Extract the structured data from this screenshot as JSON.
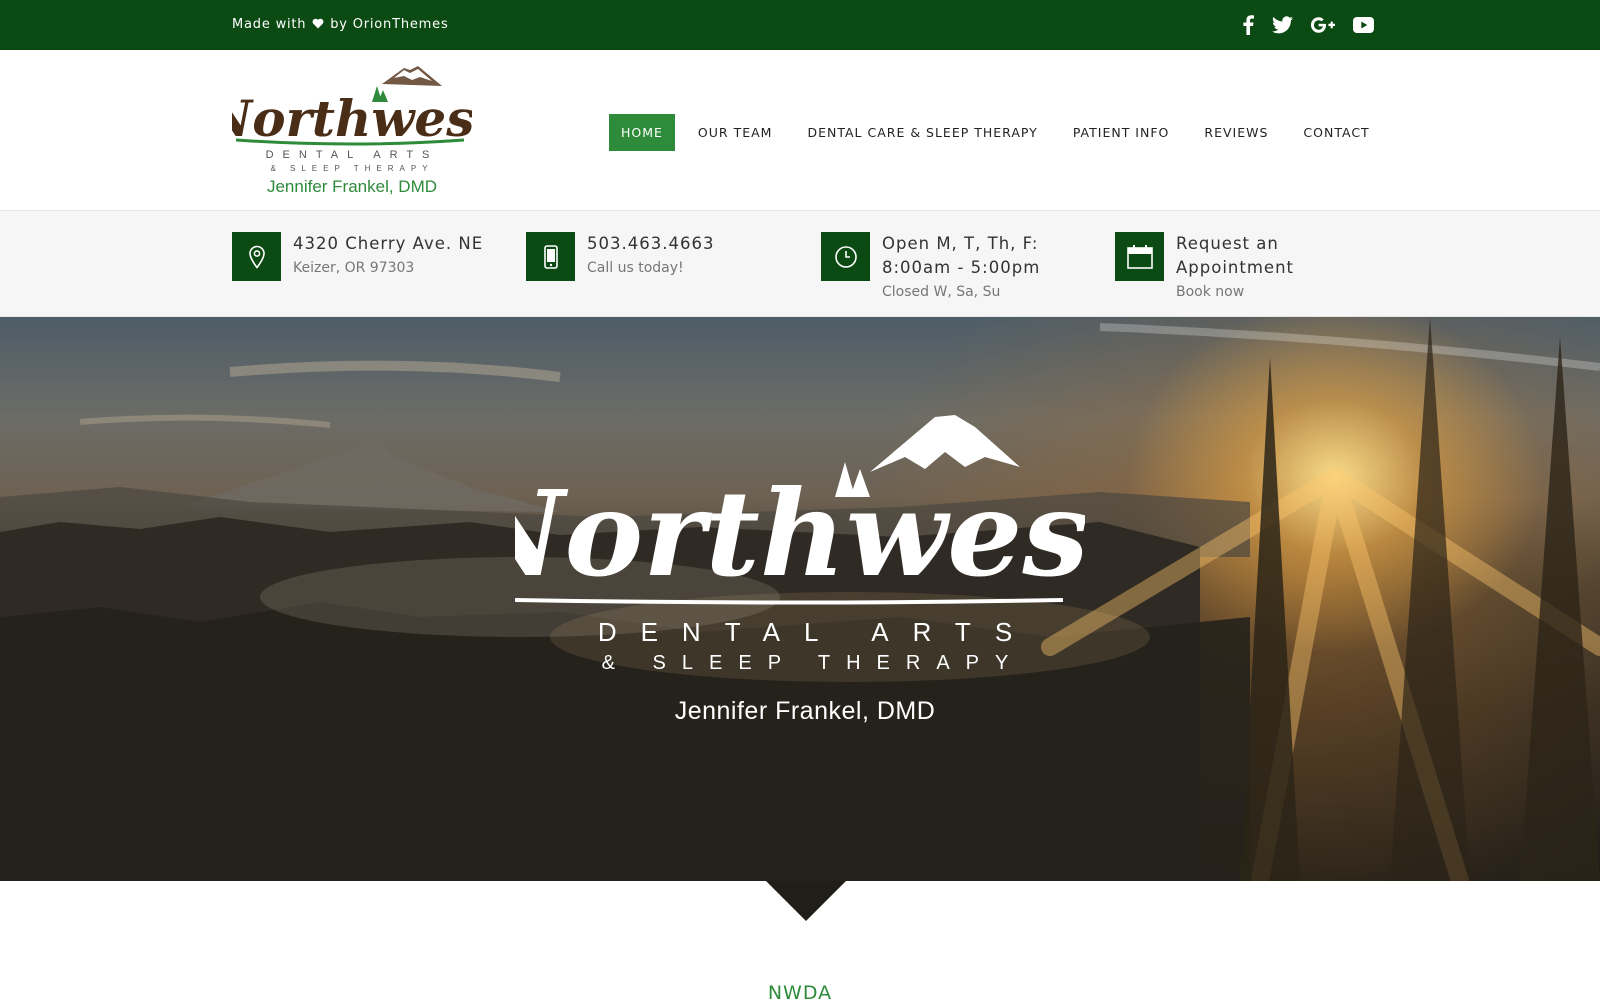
{
  "topbar": {
    "made_with": "Made with",
    "by": "by",
    "author": "OrionThemes",
    "social": [
      {
        "icon": "facebook-icon"
      },
      {
        "icon": "twitter-icon"
      },
      {
        "icon": "google-plus-icon"
      },
      {
        "icon": "youtube-icon"
      }
    ]
  },
  "logo": {
    "brand": "Northwest",
    "line1": "DENTAL ARTS",
    "line2": "& SLEEP THERAPY",
    "dentist": "Jennifer Frankel, DMD"
  },
  "nav": {
    "items": [
      {
        "label": "HOME",
        "active": true
      },
      {
        "label": "OUR TEAM"
      },
      {
        "label": "DENTAL CARE & SLEEP THERAPY"
      },
      {
        "label": "PATIENT INFO"
      },
      {
        "label": "REVIEWS"
      },
      {
        "label": "CONTACT"
      }
    ]
  },
  "info": [
    {
      "icon": "map-pin-icon",
      "title": "4320 Cherry Ave. NE",
      "sub": "Keizer, OR 97303"
    },
    {
      "icon": "phone-icon",
      "title": "503.463.4663",
      "sub": "Call us today!"
    },
    {
      "icon": "clock-icon",
      "title_line1": "Open M, T, Th, F:",
      "title_line2": "8:00am - 5:00pm",
      "sub": "Closed W, Sa, Su"
    },
    {
      "icon": "calendar-icon",
      "title_line1": "Request an",
      "title_line2": "Appointment",
      "sub": "Book now"
    }
  ],
  "hero": {
    "brand": "Northwest",
    "line1": "DENTAL ARTS",
    "line2": "& SLEEP THERAPY",
    "dentist": "Jennifer Frankel, DMD"
  },
  "section": {
    "title": "NWDA"
  },
  "colors": {
    "dark_green": "#0b4a12",
    "accent_green": "#2e8b3a"
  }
}
